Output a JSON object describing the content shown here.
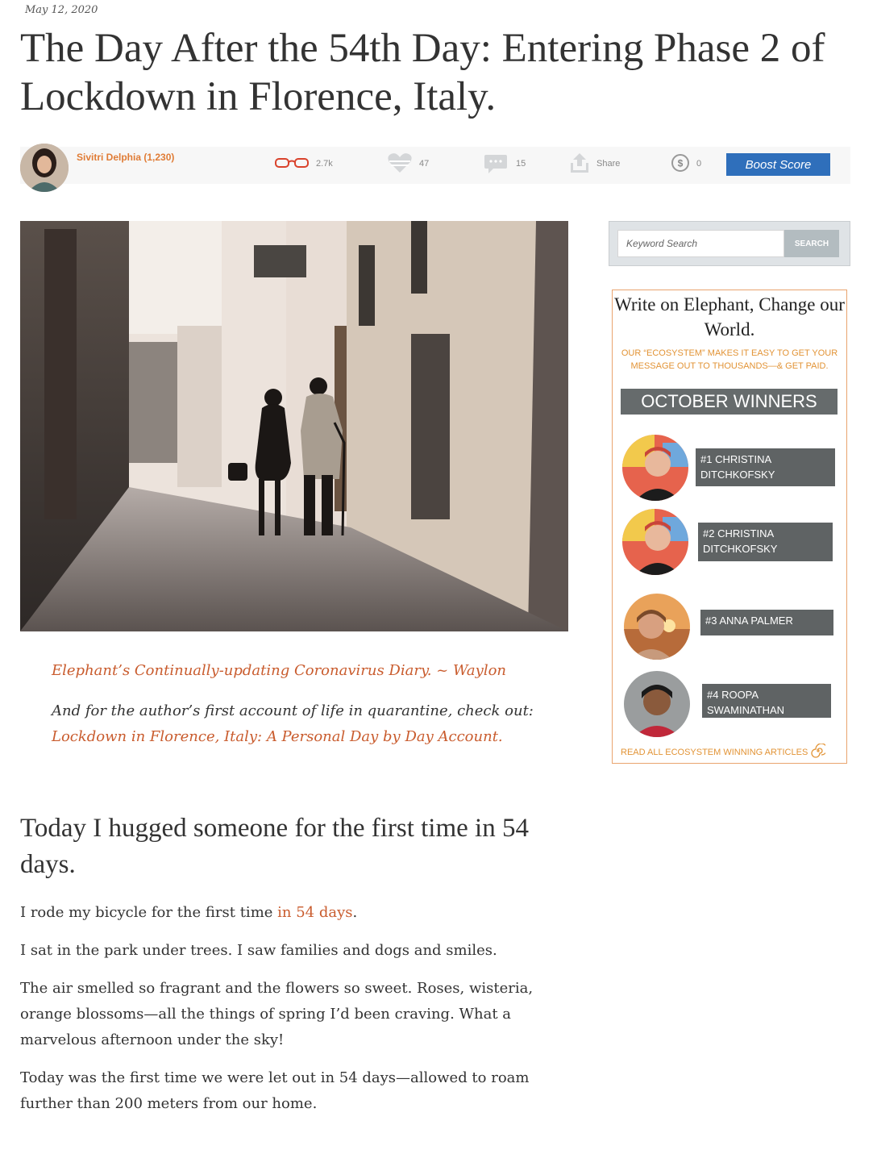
{
  "article": {
    "date": "May 12, 2020",
    "title": "The Day After the 54th Day: Entering Phase 2 of Lockdown in Florence, Italy."
  },
  "meta": {
    "author": "Sivitri Delphia (1,230)",
    "reads": "2.7k",
    "hearts": "47",
    "comments": "15",
    "share": "Share",
    "score": "0",
    "boost": "Boost Score"
  },
  "captions": {
    "diary": "Elephant’s Continually-updating Coronavirus Diary. ~ Waylon",
    "intro": "And for the author’s first account of life in quarantine, check out:",
    "link": "Lockdown in Florence, Italy: A Personal Day by Day Account."
  },
  "body": {
    "heading": "Today I hugged someone for the first time in 54 days.",
    "p1_text": "I rode my bicycle for the first time",
    "p1_link": "in 54 days",
    "p1_end": ".",
    "p2": "I sat in the park under trees. I saw families and dogs and smiles.",
    "p3": "The air smelled so fragrant and the flowers so sweet. Roses, wisteria, orange blossoms—all the things of spring I’d been craving. What a marvelous afternoon under the sky!",
    "p4": "Today was the first time we were let out in 54 days—allowed to roam further than 200 meters from our home."
  },
  "sidebar": {
    "search_placeholder": "Keyword Search",
    "search_button": "SEARCH",
    "promo_heading": "Write on Elephant, Change our World.",
    "promo_sub": "OUR “ECOSYSTEM” MAKES IT EASY TO GET YOUR MESSAGE OUT TO THOUSANDS—& GET PAID.",
    "winners_title": "OCTOBER WINNERS",
    "winners": [
      {
        "label": "#1 CHRISTINA DITCHKOFSKY"
      },
      {
        "label": "#2 CHRISTINA DITCHKOFSKY"
      },
      {
        "label": "#3 ANNA PALMER"
      },
      {
        "label": "#4 ROOPA SWAMINATHAN"
      }
    ],
    "read_all": "READ ALL ECOSYSTEM WINNING ARTICLES"
  },
  "colors": {
    "accent": "#c95c2e",
    "orange": "#e29335",
    "boost_blue": "#2f6fbb",
    "winner_bg": "#5f6364"
  },
  "icons": [
    "glasses-icon",
    "heart-icon",
    "comment-icon",
    "share-icon",
    "dollar-icon",
    "spiral-icon"
  ]
}
